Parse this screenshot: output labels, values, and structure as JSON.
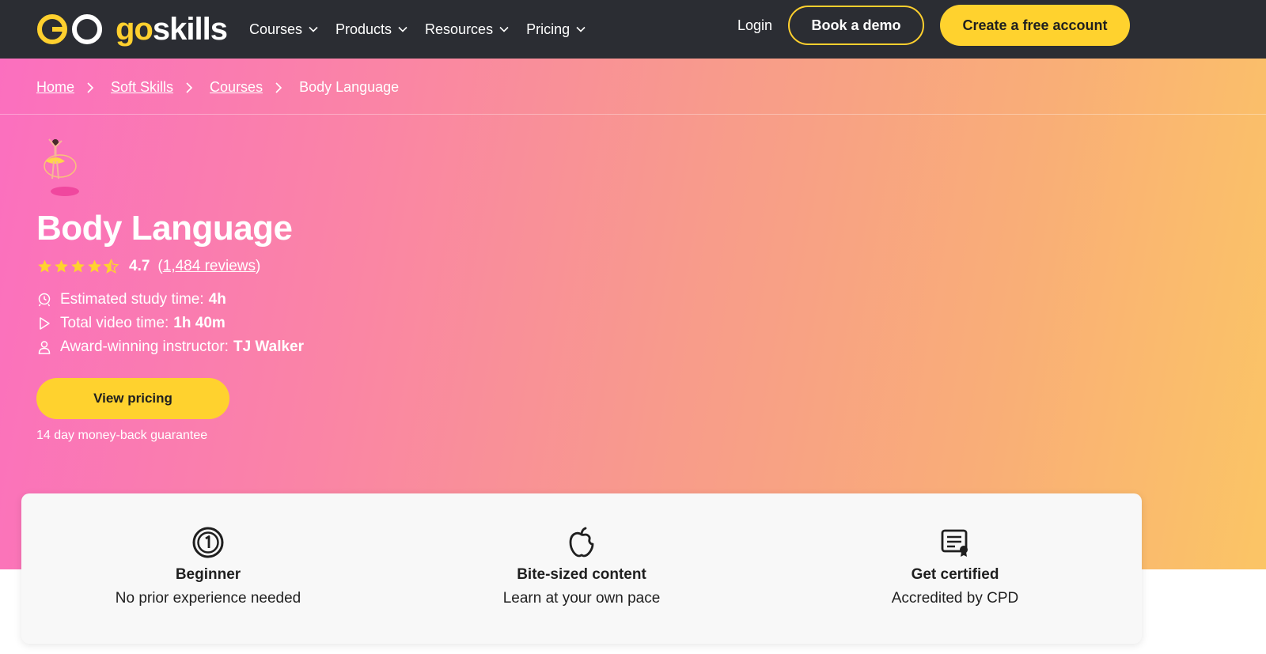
{
  "nav": {
    "logo_go": "go",
    "logo_skills": "skills",
    "menu": [
      {
        "label": "Courses"
      },
      {
        "label": "Products"
      },
      {
        "label": "Resources"
      },
      {
        "label": "Pricing"
      }
    ],
    "login": "Login",
    "demo_button": "Book a demo",
    "free_button": "Create a free account"
  },
  "breadcrumb": {
    "items": [
      "Home",
      "Soft Skills",
      "Courses"
    ],
    "current": "Body Language"
  },
  "course": {
    "title": "Body Language",
    "rating": "4.7",
    "rating_stars": 4.7,
    "reviews": "1,484 reviews",
    "reviews_open": "(",
    "reviews_close": ")",
    "meta": [
      {
        "icon": "clock-icon",
        "label": "Estimated study time:",
        "value": "4h"
      },
      {
        "icon": "play-icon",
        "label": "Total video time:",
        "value": "1h 40m"
      },
      {
        "icon": "user-icon",
        "label": "Award-winning instructor:",
        "value": "TJ Walker"
      }
    ],
    "pricing_button": "View pricing",
    "guarantee": "14 day money-back guarantee"
  },
  "features": [
    {
      "icon": "number-one-icon",
      "title": "Beginner",
      "subtitle": "No prior experience needed"
    },
    {
      "icon": "apple-icon",
      "title": "Bite-sized content",
      "subtitle": "Learn at your own pace"
    },
    {
      "icon": "certificate-icon",
      "title": "Get certified",
      "subtitle": "Accredited by CPD"
    }
  ],
  "colors": {
    "nav_bg": "#2b2d33",
    "accent_yellow": "#ffd22e",
    "hero_gradient": [
      "#fb6fbf",
      "#f89c8a",
      "#fbc565"
    ]
  }
}
